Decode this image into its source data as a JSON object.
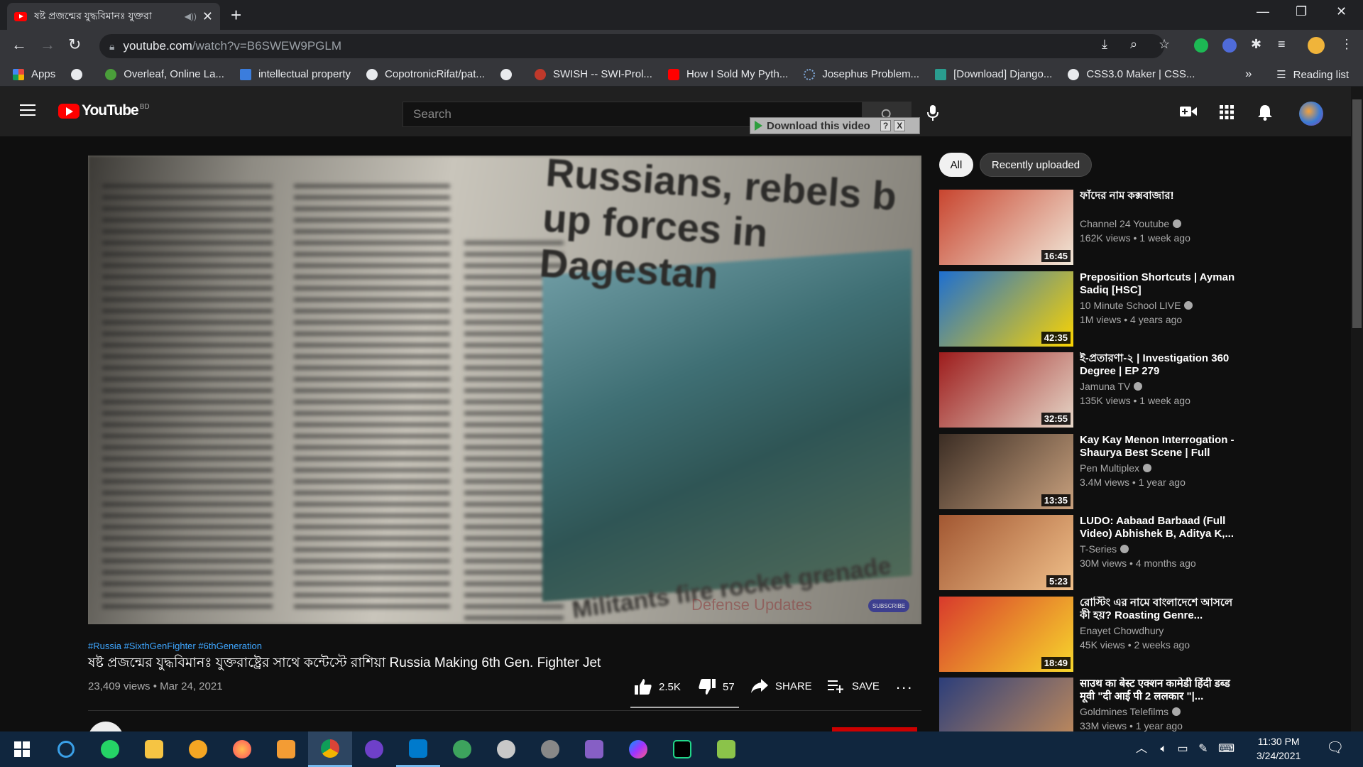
{
  "browser": {
    "tab_title": "ষষ্ট প্রজন্মের যুদ্ধবিমানঃ যুক্তরা",
    "url_domain": "youtube.com",
    "url_path": "/watch?v=B6SWEW9PGLM",
    "bookmarks": [
      {
        "label": "Apps",
        "color": "#e8453c"
      },
      {
        "label": "",
        "color": "#e8eaed"
      },
      {
        "label": "Overleaf, Online La...",
        "color": "#4a9e3a"
      },
      {
        "label": "intellectual property",
        "color": "#3b7ddd"
      },
      {
        "label": "CopotronicRifat/pat...",
        "color": "#e8eaed"
      },
      {
        "label": "",
        "color": "#e8eaed"
      },
      {
        "label": "SWISH -- SWI-Prol...",
        "color": "#c0392b"
      },
      {
        "label": "How I Sold My Pyth...",
        "color": "#ff0000"
      },
      {
        "label": "Josephus Problem...",
        "color": "#7fa8d8"
      },
      {
        "label": "[Download] Django...",
        "color": "#2a9d8f"
      },
      {
        "label": "CSS3.0 Maker | CSS...",
        "color": "#e8eaed"
      }
    ],
    "more": "»",
    "reading_list": "Reading list"
  },
  "youtube": {
    "logo": "YouTube",
    "country": "BD",
    "search_placeholder": "Search",
    "download_label": "Download this video",
    "download_help": "?",
    "download_close": "X"
  },
  "player": {
    "headline_1": "Russians, rebels b",
    "headline_2": "up forces in Dagestan",
    "footer_text": "Militants fire rocket grenade",
    "watermark": "Defense Updates",
    "subscribe_badge": "SUBSCRIBE"
  },
  "video": {
    "hashtags": "#Russia #SixthGenFighter #6thGeneration",
    "title": "ষষ্ট প্রজন্মের যুদ্ধবিমানঃ যুক্তরাষ্ট্রের সাথে কন্টেস্টে রাশিয়া Russia Making 6th Gen. Fighter Jet",
    "views": "23,409 views",
    "date": "Mar 24, 2021",
    "likes": "2.5K",
    "dislikes": "57",
    "share": "SHARE",
    "save": "SAVE",
    "more": "..."
  },
  "chips": [
    "All",
    "Recently uploaded"
  ],
  "recommendations": [
    {
      "title": "ফাঁদের নাম কক্সবাজার!",
      "channel": "Channel 24 Youtube",
      "verified": true,
      "meta": "162K views • 1 week ago",
      "duration": "16:45",
      "thumb_colors": [
        "#c8452f",
        "#f1e7d8"
      ]
    },
    {
      "title": "Preposition Shortcuts | Ayman Sadiq [HSC]",
      "channel": "10 Minute School LIVE",
      "verified": true,
      "meta": "1M views • 4 years ago",
      "duration": "42:35",
      "thumb_colors": [
        "#1e6fd0",
        "#fbd400"
      ]
    },
    {
      "title": "ই-প্রতারণা-২ | Investigation 360 Degree | EP 279",
      "channel": "Jamuna TV",
      "verified": true,
      "meta": "135K views • 1 week ago",
      "duration": "32:55",
      "thumb_colors": [
        "#9d1c1c",
        "#e6d7c8"
      ]
    },
    {
      "title": "Kay Kay Menon Interrogation - Shaurya Best Scene | Full Hind...",
      "channel": "Pen Multiplex",
      "verified": true,
      "meta": "3.4M views • 1 year ago",
      "duration": "13:35",
      "thumb_colors": [
        "#3b2d24",
        "#c9a17e"
      ]
    },
    {
      "title": "LUDO: Aabaad Barbaad (Full Video) Abhishek B, Aditya K,...",
      "channel": "T-Series",
      "verified": true,
      "meta": "30M views • 4 months ago",
      "duration": "5:23",
      "thumb_colors": [
        "#a25732",
        "#f0c08a"
      ]
    },
    {
      "title": "রোস্টিং এর নামে বাংলাদেশে আসলে কী হয়? Roasting Genre...",
      "channel": "Enayet Chowdhury",
      "verified": false,
      "meta": "45K views • 2 weeks ago",
      "duration": "18:49",
      "thumb_colors": [
        "#d83a2c",
        "#f7d72c"
      ]
    },
    {
      "title": "साउथ का बेस्ट एक्शन कामेडी हिंदी डब्ड मूवी \"दी आई पी 2 ललकार \"|...",
      "channel": "Goldmines Telefilms",
      "verified": true,
      "meta": "33M views • 1 year ago",
      "duration": "",
      "thumb_colors": [
        "#2c3e7a",
        "#c98f5a"
      ]
    }
  ],
  "taskbar": {
    "time": "11:30 PM",
    "date": "3/24/2021"
  }
}
